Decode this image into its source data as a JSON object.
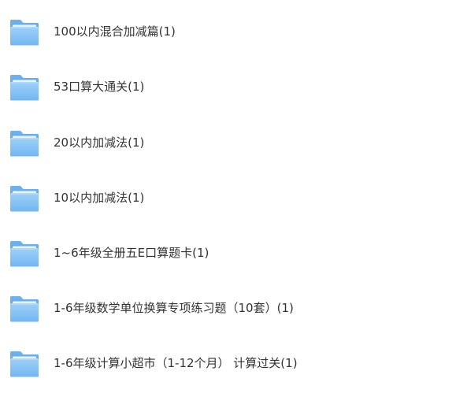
{
  "folders": [
    {
      "label": "100以内混合加减篇(1)",
      "icon": "folder-icon"
    },
    {
      "label": "53口算大通关(1)",
      "icon": "folder-icon"
    },
    {
      "label": "20以内加减法(1)",
      "icon": "folder-icon"
    },
    {
      "label": "10以内加减法(1)",
      "icon": "folder-icon"
    },
    {
      "label": "1~6年级全册五E口算题卡(1)",
      "icon": "folder-icon"
    },
    {
      "label": "1-6年级数学单位换算专项练习题（10套）(1)",
      "icon": "folder-icon"
    },
    {
      "label": "1-6年级计算小超市（1-12个月） 计算过关(1)",
      "icon": "folder-icon"
    }
  ],
  "colors": {
    "folder_back": "#5aa6ea",
    "folder_front_top": "#9ed0f8",
    "folder_front_bottom": "#72b6f2",
    "label_text": "#333333"
  }
}
